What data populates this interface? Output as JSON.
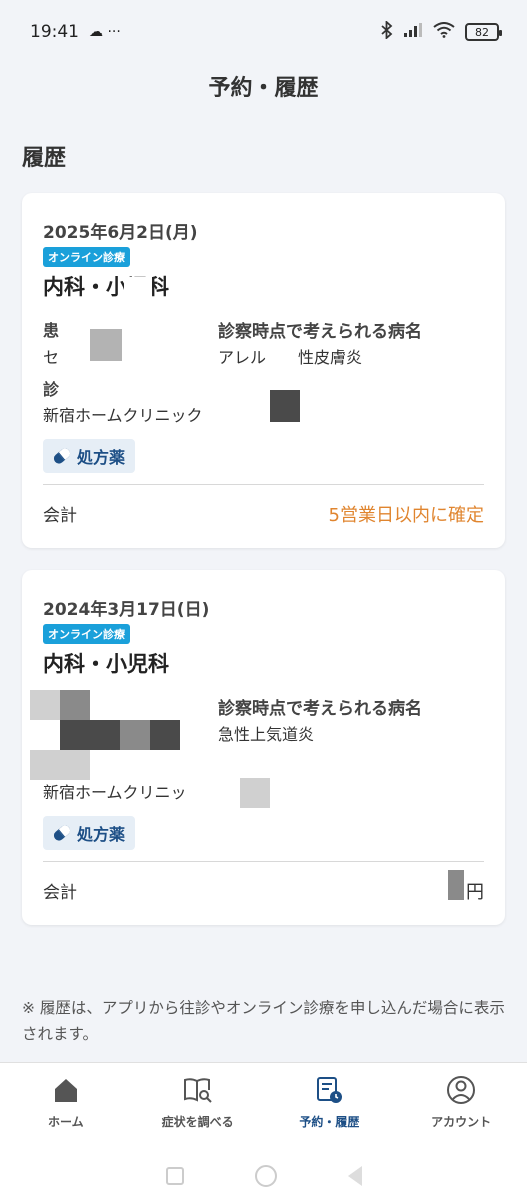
{
  "status_bar": {
    "time": "19:41",
    "extra": "☁ ···",
    "battery": "82"
  },
  "header": {
    "title": "予約・履歴"
  },
  "section": {
    "title": "履歴"
  },
  "history": [
    {
      "date": "2025年6月2日(月)",
      "visit_type": "オンライン診療",
      "department": "内科・小児科",
      "diagnosis_label": "診察時点で考えられる病名",
      "diagnosis_value": "アレル　　性皮膚炎",
      "left_label_1": "患",
      "left_value_1": "セ",
      "left_label_2": "診",
      "clinic": "新宿ホームクリニック",
      "prescription_label": "処方薬",
      "billing_label": "会計",
      "billing_value": "5営業日以内に確定"
    },
    {
      "date": "2024年3月17日(日)",
      "visit_type": "オンライン診療",
      "department": "内科・小児科",
      "diagnosis_label": "診察時点で考えられる病名",
      "diagnosis_value": "急性上気道炎",
      "clinic": "新宿ホームクリニッ",
      "prescription_label": "処方薬",
      "billing_label": "会計",
      "billing_value": "円"
    }
  ],
  "note": "※ 履歴は、アプリから往診やオンライン診療を申し込んだ場合に表示されます。",
  "tabs": [
    {
      "label": "ホーム",
      "icon": "home-icon",
      "active": false
    },
    {
      "label": "症状を調べる",
      "icon": "book-search-icon",
      "active": false
    },
    {
      "label": "予約・履歴",
      "icon": "calendar-history-icon",
      "active": true
    },
    {
      "label": "アカウント",
      "icon": "account-icon",
      "active": false
    }
  ],
  "colors": {
    "accent": "#1d4f86",
    "badge": "#1aa0da",
    "pending": "#e0852f",
    "background": "#f2f4f8"
  }
}
